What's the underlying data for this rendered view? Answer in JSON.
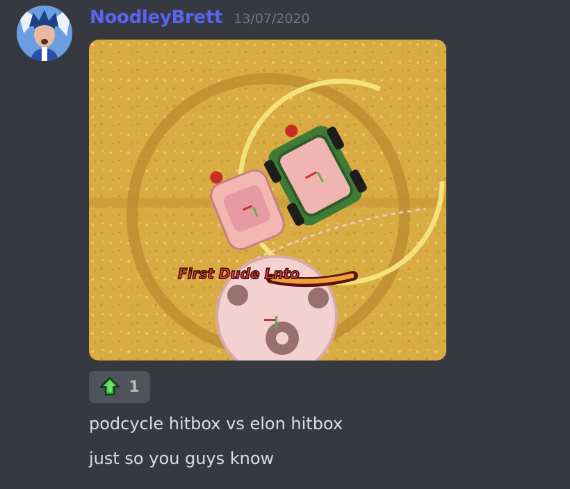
{
  "message": {
    "author": "NoodleyBrett",
    "timestamp": "13/07/2020",
    "avatar_icon": "user-avatar",
    "attachment": {
      "icon": "game-screenshot-image",
      "caption_in_image": "First Dude Lnto"
    },
    "reaction": {
      "emoji": "green-up-arrow-icon",
      "count": "1"
    },
    "lines": [
      "podcycle hitbox vs elon hitbox",
      "just so you guys know"
    ]
  },
  "colors": {
    "background": "#36393f",
    "username": "#5865f2",
    "timestamp": "#72767d",
    "text": "#dcddde",
    "reaction_bg": "#4f545c"
  }
}
